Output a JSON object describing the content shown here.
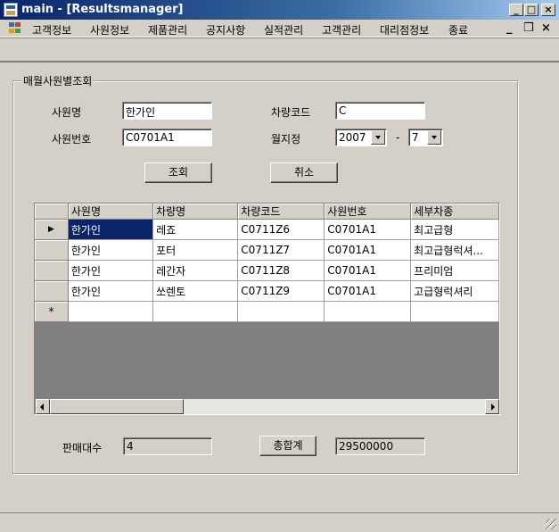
{
  "window": {
    "title": "main - [Resultsmanager]",
    "minimize": "_",
    "maximize": "□",
    "close": "×"
  },
  "menu": {
    "items": [
      "고객정보",
      "사원정보",
      "제품관리",
      "공지사항",
      "실적관리",
      "고객관리",
      "대리점정보",
      "종료"
    ],
    "mdi_minimize": "_",
    "mdi_restore": "❐",
    "mdi_close": "×"
  },
  "group": {
    "title": "매월사원별조회"
  },
  "form": {
    "employee_name_label": "사원명",
    "employee_name_value": "한가인",
    "vehicle_code_label": "차량코드",
    "vehicle_code_value": "C",
    "employee_no_label": "사원번호",
    "employee_no_value": "C0701A1",
    "month_label": "월지정",
    "year_value": "2007",
    "dash": "-",
    "month_value": "7",
    "search_button": "조회",
    "cancel_button": "취소"
  },
  "grid": {
    "columns": [
      "사원명",
      "차량명",
      "차량코드",
      "사원번호",
      "세부차종"
    ],
    "rows": [
      [
        "한가인",
        "레죠",
        "C0711Z6",
        "C0701A1",
        "최고급형"
      ],
      [
        "한가인",
        "포터",
        "C0711Z7",
        "C0701A1",
        "최고급형럭셔..."
      ],
      [
        "한가인",
        "레간자",
        "C0711Z8",
        "C0701A1",
        "프리미엄"
      ],
      [
        "한가인",
        "쏘렌토",
        "C0711Z9",
        "C0701A1",
        "고급형럭셔리"
      ]
    ],
    "current_row_marker": "▶",
    "new_row_marker": "*"
  },
  "footer": {
    "sales_count_label": "판매대수",
    "sales_count_value": "4",
    "total_button": "총합계",
    "total_value": "29500000"
  }
}
